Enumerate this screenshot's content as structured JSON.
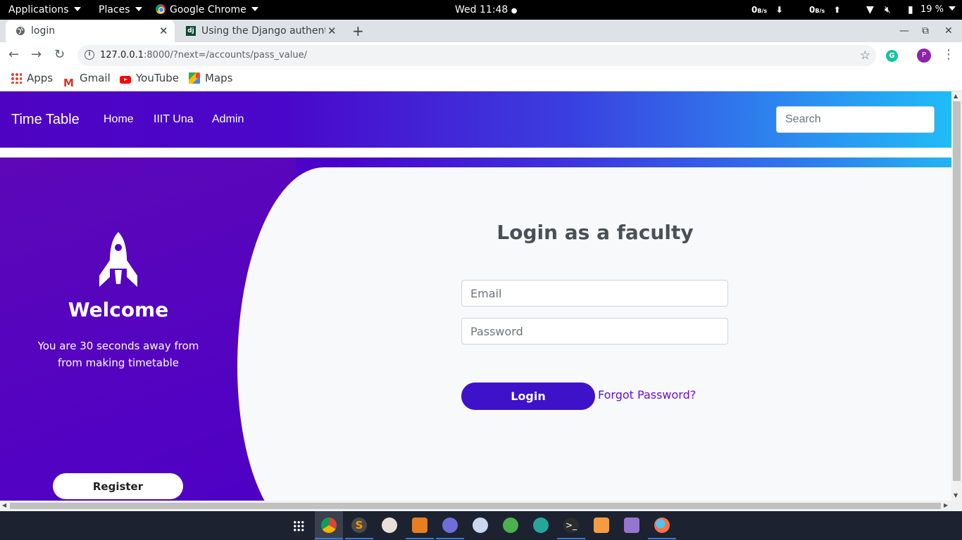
{
  "topbar": {
    "applications": "Applications",
    "places": "Places",
    "app_name": "Google Chrome",
    "clock": "Wed 11:48",
    "net_down": "0",
    "net_down_unit": "B/s",
    "net_up": "0",
    "net_up_unit": "B/s",
    "battery": "19 %"
  },
  "tabs": [
    {
      "title": "login",
      "favicon": "globe-icon",
      "active": true
    },
    {
      "title": "Using the Django authenti",
      "favicon": "django-icon",
      "active": false
    }
  ],
  "new_tab": "+",
  "address": {
    "host": "127.0.0.1",
    "rest": ":8000/?next=/accounts/pass_value/"
  },
  "profile_initial": "P",
  "bookmarks": [
    {
      "label": "Apps",
      "icon": "apps-grid-icon"
    },
    {
      "label": "Gmail",
      "icon": "gmail-icon"
    },
    {
      "label": "YouTube",
      "icon": "youtube-icon"
    },
    {
      "label": "Maps",
      "icon": "maps-icon"
    }
  ],
  "page": {
    "brand": "Time Table",
    "nav": [
      "Home",
      "IIIT Una",
      "Admin"
    ],
    "search_placeholder": "Search",
    "welcome": "Welcome",
    "subtitle": "You are 30 seconds away from from making timetable",
    "register": "Register",
    "form_title": "Login as a faculty",
    "email_placeholder": "Email",
    "password_placeholder": "Password",
    "login": "Login",
    "forgot": "Forgot Password?"
  },
  "colors": {
    "accent": "#3e12c9",
    "link": "#6a0dd8",
    "nav_start": "#4f03c2",
    "nav_end": "#1fbcf7"
  },
  "dock": [
    "grid-icon",
    "chrome-icon",
    "sublime-icon",
    "atom-icon",
    "archive-icon",
    "files-icon",
    "image-viewer-icon",
    "settings-icon",
    "system-monitor-icon",
    "terminal-icon",
    "presentation-icon",
    "text-editor-icon",
    "firefox-icon"
  ]
}
